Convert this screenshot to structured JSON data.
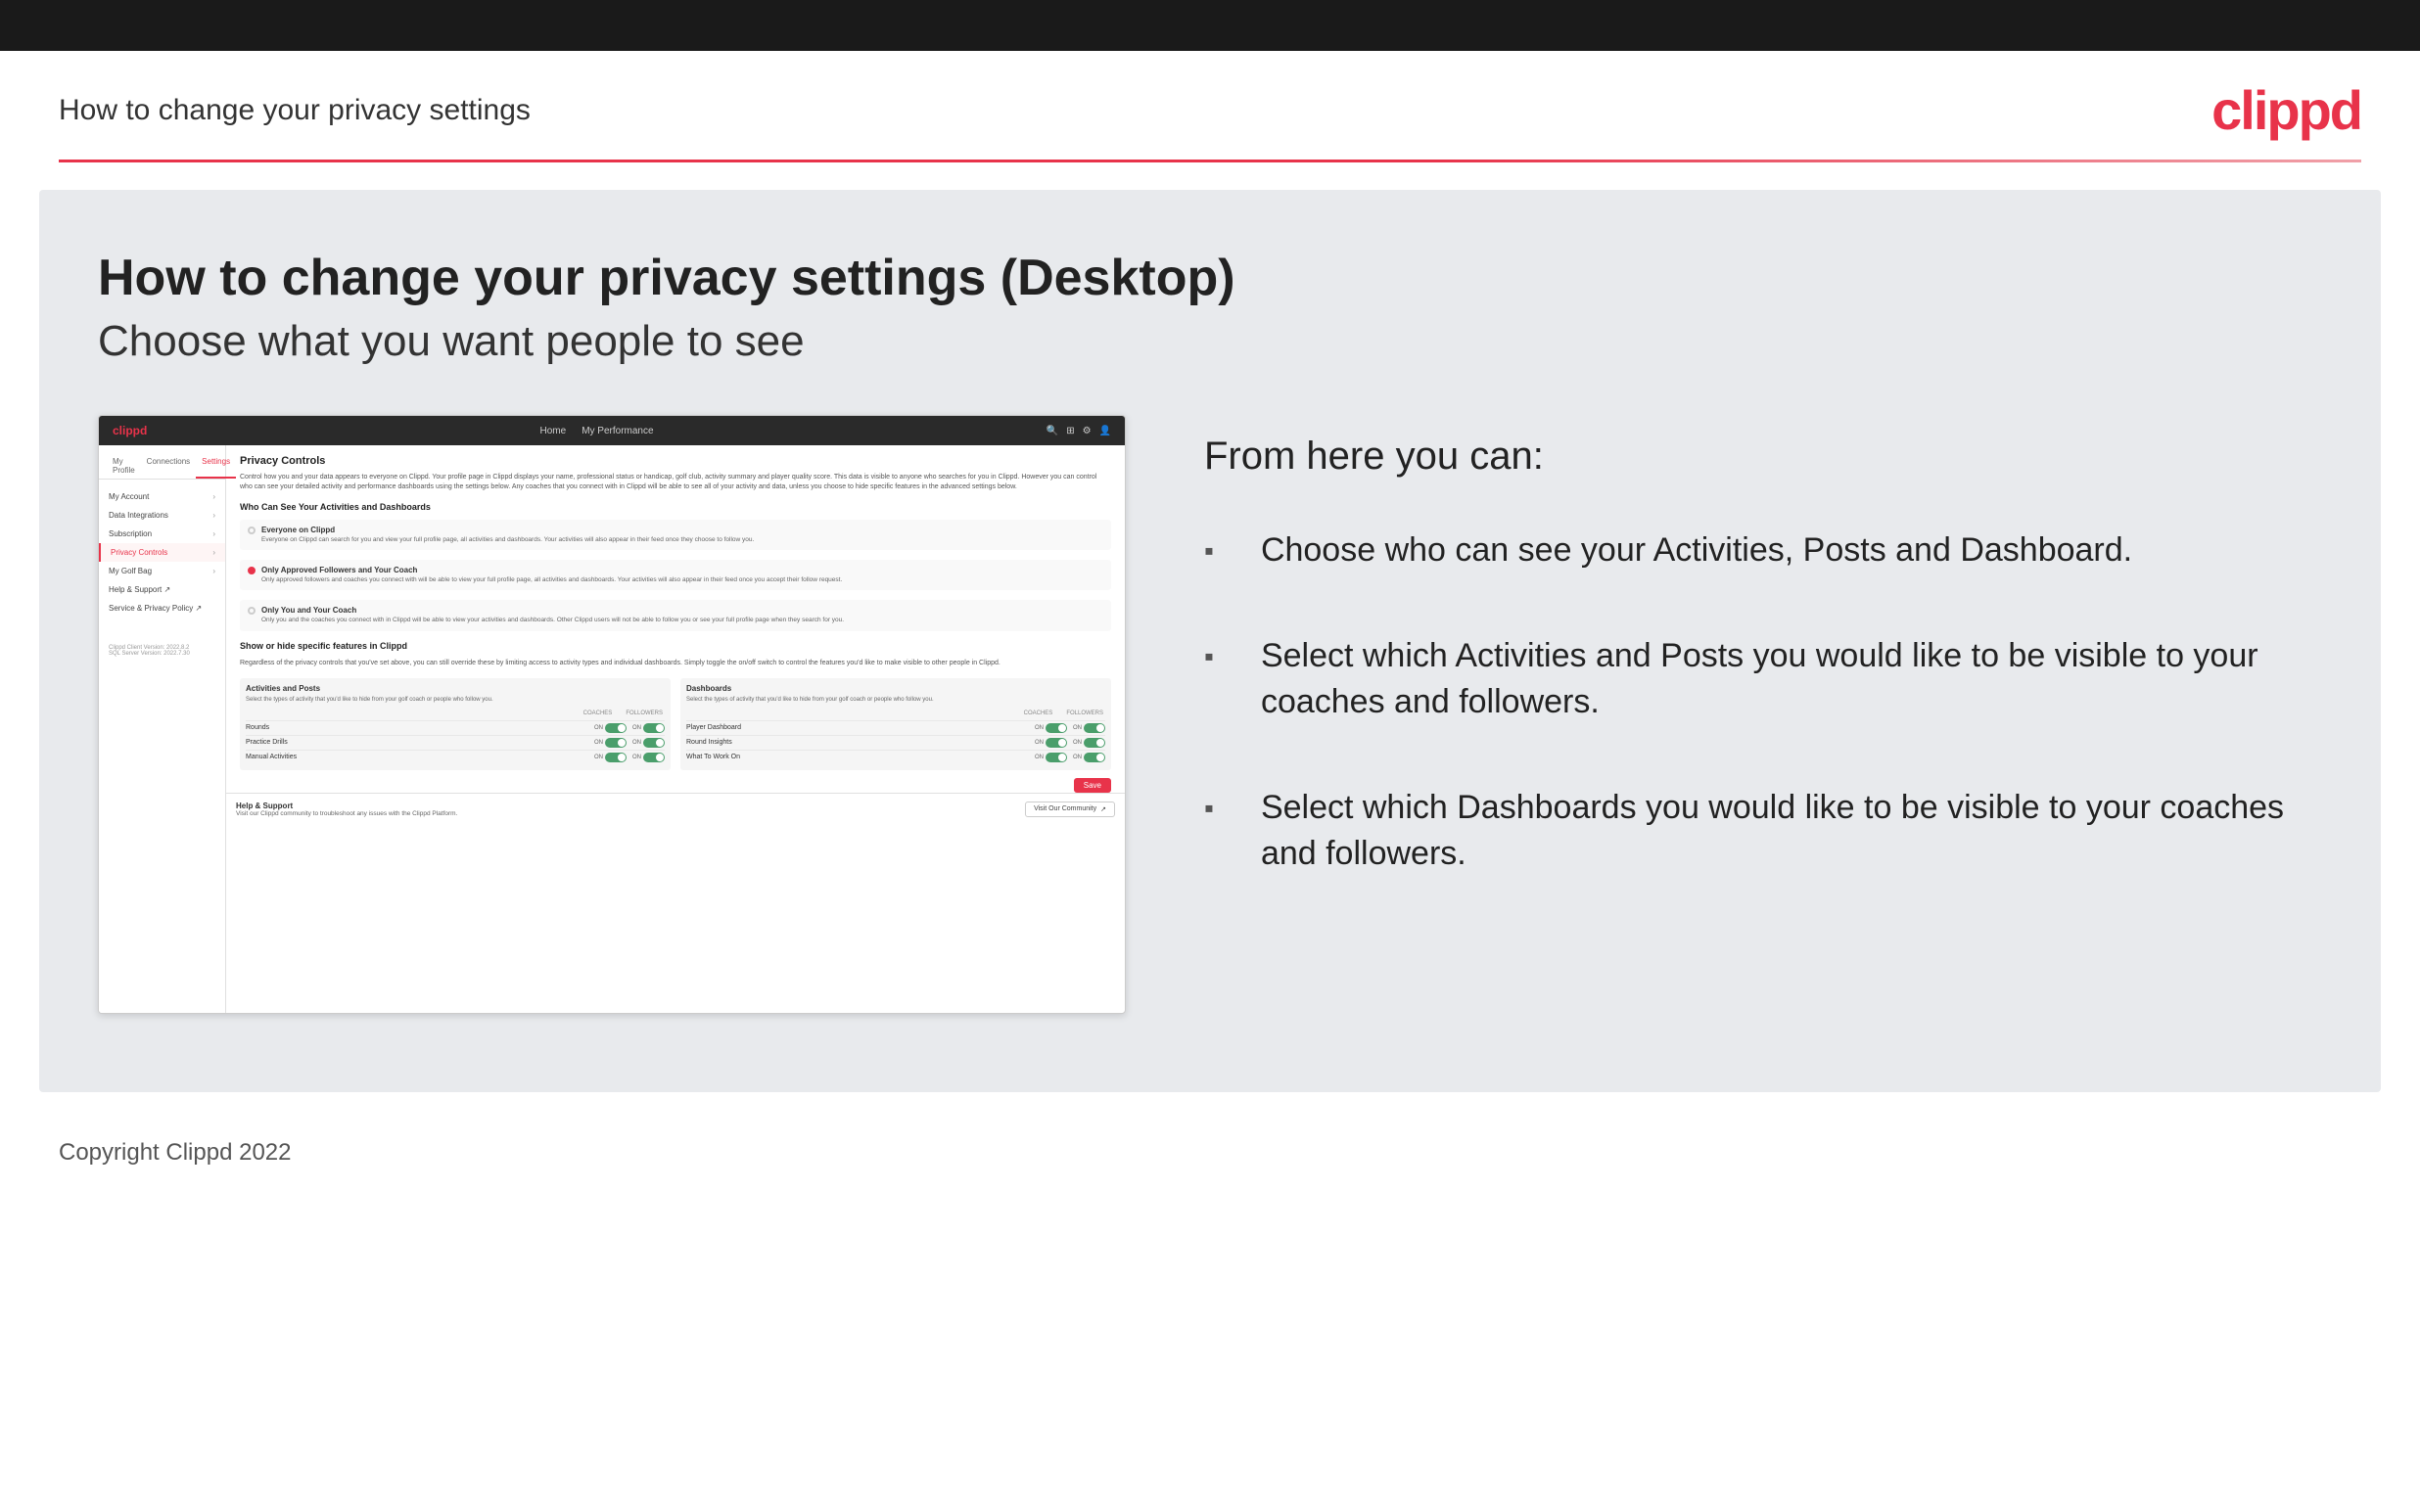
{
  "topbar": {},
  "header": {
    "title": "How to change your privacy settings",
    "logo": "clippd"
  },
  "main": {
    "heading": "How to change your privacy settings (Desktop)",
    "subheading": "Choose what you want people to see",
    "from_here_label": "From here you can:",
    "bullets": [
      "Choose who can see your Activities, Posts and Dashboard.",
      "Select which Activities and Posts you would like to be visible to your coaches and followers.",
      "Select which Dashboards you would like to be visible to your coaches and followers."
    ]
  },
  "app_screenshot": {
    "navbar": {
      "logo": "clippd",
      "links": [
        "Home",
        "My Performance"
      ],
      "icons": [
        "search",
        "grid",
        "settings",
        "user"
      ]
    },
    "sidebar": {
      "tabs": [
        "My Profile",
        "Connections",
        "Settings"
      ],
      "active_tab": "Settings",
      "items": [
        {
          "label": "My Account",
          "active": false
        },
        {
          "label": "Data Integrations",
          "active": false
        },
        {
          "label": "Subscription",
          "active": false
        },
        {
          "label": "Privacy Controls",
          "active": true
        },
        {
          "label": "My Golf Bag",
          "active": false
        },
        {
          "label": "Help & Support",
          "active": false
        },
        {
          "label": "Service & Privacy Policy",
          "active": false
        }
      ],
      "version": "Clippd Client Version: 2022.8.2\nSQL Server Version: 2022.7.30"
    },
    "privacy_controls": {
      "title": "Privacy Controls",
      "description": "Control how you and your data appears to everyone on Clippd. Your profile page in Clippd displays your name, professional status or handicap, golf club, activity summary and player quality score. This data is visible to anyone who searches for you in Clippd. However you can control who can see your detailed activity and performance dashboards using the settings below. Any coaches that you connect with in Clippd will be able to see all of your activity and data, unless you choose to hide specific features in the advanced settings below.",
      "who_can_see_label": "Who Can See Your Activities and Dashboards",
      "options": [
        {
          "id": "everyone",
          "label": "Everyone on Clippd",
          "description": "Everyone on Clippd can search for you and view your full profile page, all activities and dashboards. Your activities will also appear in their feed once they choose to follow you.",
          "selected": false
        },
        {
          "id": "approved_followers",
          "label": "Only Approved Followers and Your Coach",
          "description": "Only approved followers and coaches you connect with will be able to view your full profile page, all activities and dashboards. Your activities will also appear in their feed once you accept their follow request.",
          "selected": true
        },
        {
          "id": "only_you",
          "label": "Only You and Your Coach",
          "description": "Only you and the coaches you connect with in Clippd will be able to view your activities and dashboards. Other Clippd users will not be able to follow you or see your full profile page when they search for you.",
          "selected": false
        }
      ],
      "show_hide_label": "Show or hide specific features in Clippd",
      "show_hide_desc": "Regardless of the privacy controls that you've set above, you can still override these by limiting access to activity types and individual dashboards. Simply toggle the on/off switch to control the features you'd like to make visible to other people in Clippd.",
      "activities_posts": {
        "title": "Activities and Posts",
        "description": "Select the types of activity that you'd like to hide from your golf coach or people who follow you.",
        "headers": [
          "COACHES",
          "FOLLOWERS"
        ],
        "rows": [
          {
            "label": "Rounds",
            "coaches_on": true,
            "followers_on": true
          },
          {
            "label": "Practice Drills",
            "coaches_on": true,
            "followers_on": true
          },
          {
            "label": "Manual Activities",
            "coaches_on": true,
            "followers_on": true
          }
        ]
      },
      "dashboards": {
        "title": "Dashboards",
        "description": "Select the types of activity that you'd like to hide from your golf coach or people who follow you.",
        "headers": [
          "COACHES",
          "FOLLOWERS"
        ],
        "rows": [
          {
            "label": "Player Dashboard",
            "coaches_on": true,
            "followers_on": true
          },
          {
            "label": "Round Insights",
            "coaches_on": true,
            "followers_on": true
          },
          {
            "label": "What To Work On",
            "coaches_on": true,
            "followers_on": true
          }
        ]
      },
      "save_label": "Save"
    },
    "help_section": {
      "title": "Help & Support",
      "description": "Visit our Clippd community to troubleshoot any issues with the Clippd Platform.",
      "button_label": "Visit Our Community"
    }
  },
  "footer": {
    "copyright": "Copyright Clippd 2022"
  }
}
